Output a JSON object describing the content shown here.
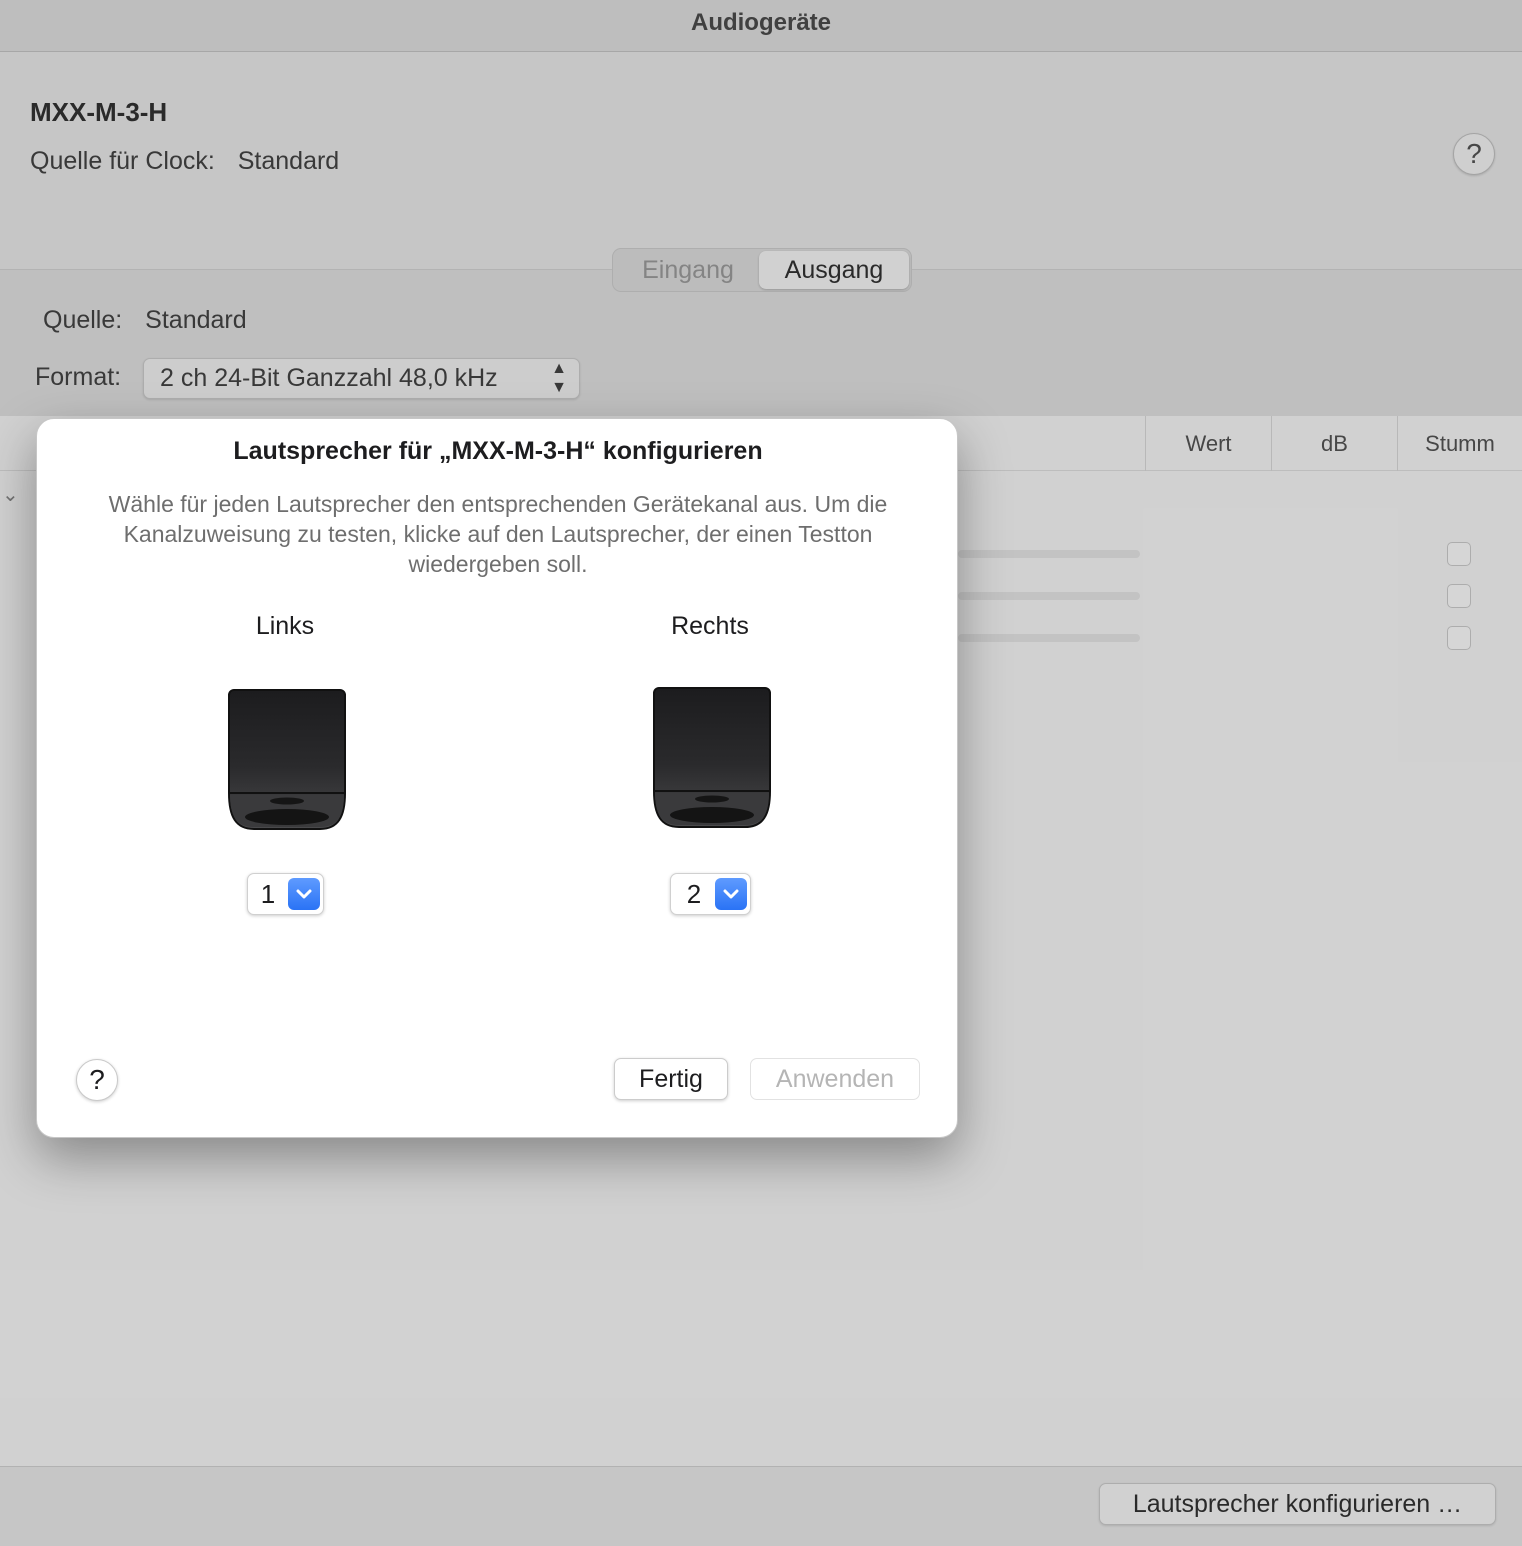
{
  "window": {
    "title": "Audiogeräte"
  },
  "device": {
    "name": "MXX-M-3-H",
    "clock_label": "Quelle für Clock:",
    "clock_value": "Standard",
    "help": "?"
  },
  "tabs": [
    {
      "label": "Eingang",
      "selected": false
    },
    {
      "label": "Ausgang",
      "selected": true
    }
  ],
  "output": {
    "source_label": "Quelle:",
    "source_value": "Standard",
    "format_label": "Format:",
    "format_value": "2 ch 24-Bit Ganzzahl 48,0 kHz"
  },
  "table": {
    "columns": [
      "Wert",
      "dB",
      "Stumm"
    ]
  },
  "bottom": {
    "configure_button": "Lautsprecher konfigurieren …"
  },
  "dialog": {
    "title": "Lautsprecher für „MXX-M-3-H“ konfigurieren",
    "description": "Wähle für jeden Lautsprecher den entsprechenden Gerätekanal aus. Um die Kanalzuweisung zu testen, klicke auf den Lautsprecher, der einen Testton wiedergeben soll.",
    "speakers": [
      {
        "label": "Links",
        "channel": "1"
      },
      {
        "label": "Rechts",
        "channel": "2"
      }
    ],
    "help": "?",
    "done_button": "Fertig",
    "apply_button": "Anwenden"
  },
  "colors": {
    "accent": "#2a73f5",
    "speaker_body": "#1f1f1f"
  }
}
